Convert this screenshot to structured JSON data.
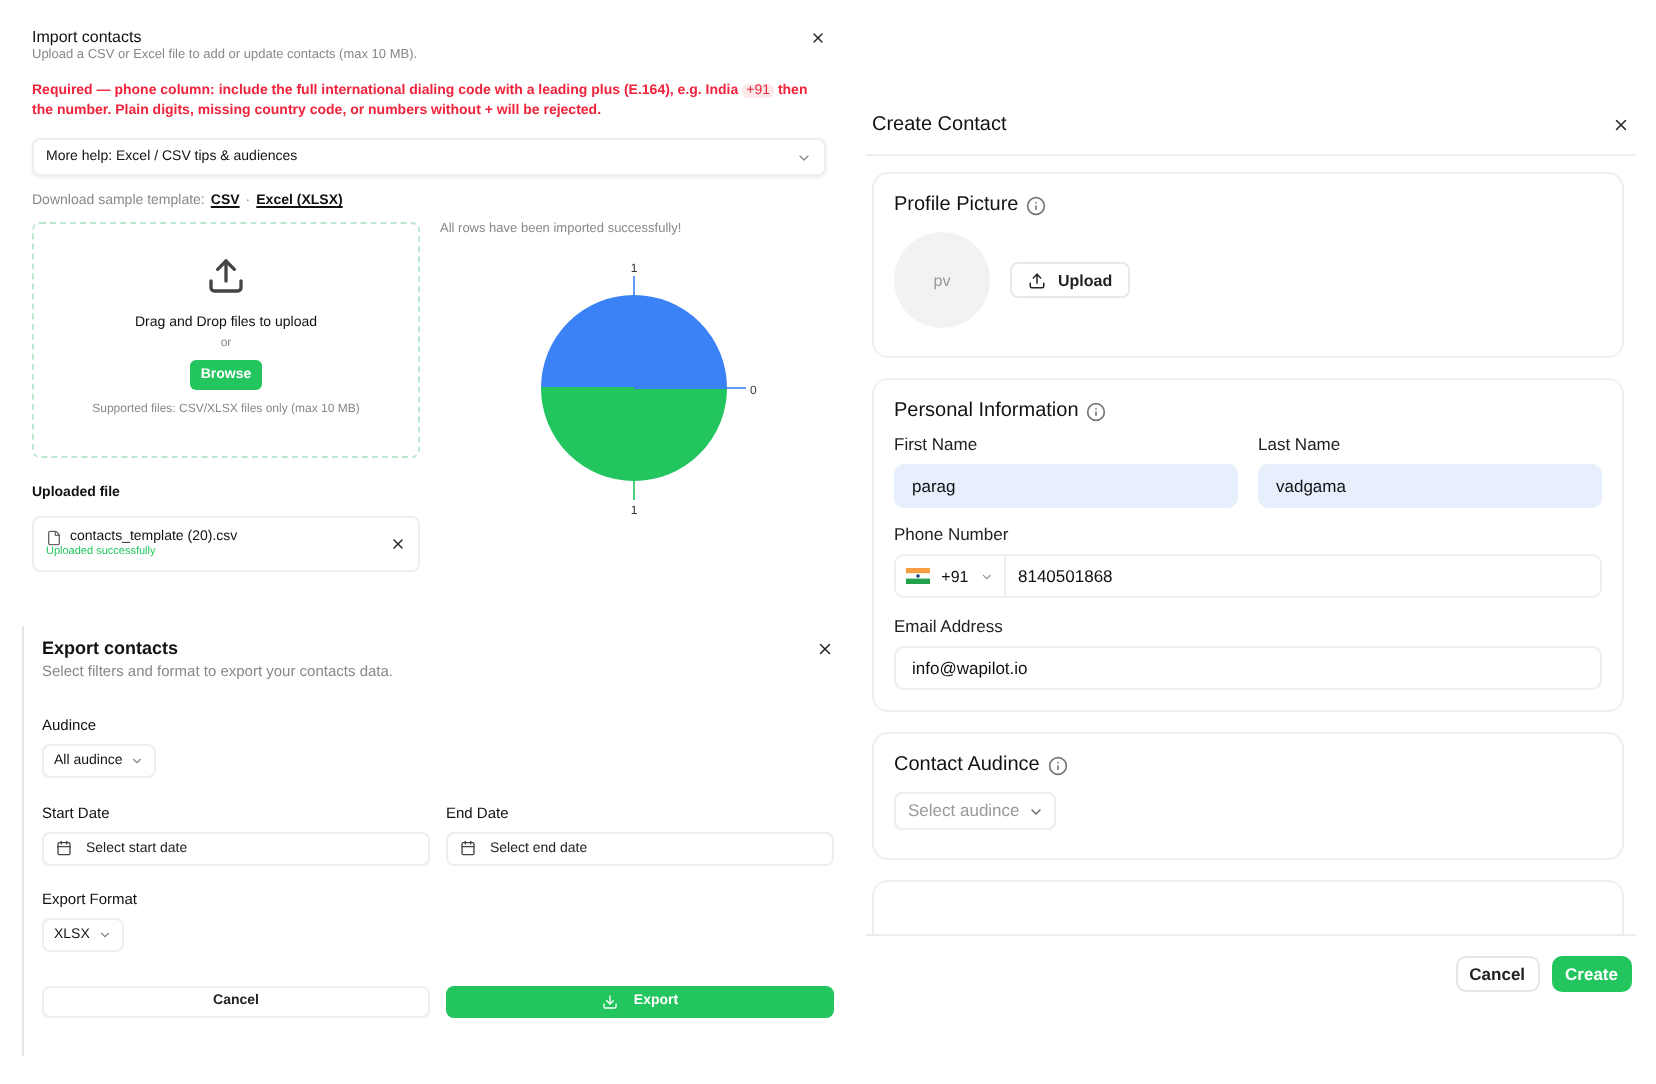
{
  "import_dialog": {
    "title": "Import contacts",
    "subtitle": "Upload a CSV or Excel file to add or update contacts (max 10 MB).",
    "warning": {
      "before": "Required — phone column: include the full international dialing code with a leading plus (E.164), e.g. India",
      "code": "+91",
      "after": "then the number. Plain digits, missing country code, or numbers without + will be rejected."
    },
    "help_accordion": {
      "label": "More help: Excel / CSV tips & audiences",
      "expanded": false
    },
    "template": {
      "label": "Download sample template:",
      "links": [
        "CSV",
        "Excel (XLSX)"
      ],
      "separator": "·"
    },
    "dropzone": {
      "title": "Drag and Drop files to upload",
      "or": "or",
      "button": "Browse",
      "hint": "Supported files: CSV/XLSX files only (max 10 MB)"
    },
    "uploaded_heading": "Uploaded file",
    "file": {
      "name": "contacts_template (20).csv",
      "status": "Uploaded successfully"
    },
    "result": {
      "message": "All rows have been imported successfully!",
      "chart_data": {
        "type": "pie",
        "values": [
          1,
          1,
          0
        ],
        "value_labels": [
          "1",
          "1",
          "0"
        ]
      }
    }
  },
  "export_dialog": {
    "title": "Export contacts",
    "subtitle": "Select filters and format to export your contacts data.",
    "audience": {
      "label": "Audince",
      "value": "All audince"
    },
    "start_date": {
      "label": "Start Date",
      "placeholder": "Select start date"
    },
    "end_date": {
      "label": "End Date",
      "placeholder": "Select end date"
    },
    "format": {
      "label": "Export Format",
      "value": "XLSX"
    },
    "buttons": [
      {
        "label": "Cancel",
        "kind": "secondary"
      },
      {
        "label": "Export",
        "kind": "primary"
      }
    ]
  },
  "create_dialog": {
    "title": "Create Contact",
    "profile": {
      "heading": "Profile Picture",
      "initials": "pv",
      "upload": "Upload"
    },
    "personal": {
      "heading": "Personal Information",
      "first_name": {
        "label": "First Name",
        "value": "parag"
      },
      "last_name": {
        "label": "Last Name",
        "value": "vadgama"
      },
      "phone": {
        "label": "Phone Number",
        "code": "+91",
        "value": "8140501868"
      },
      "email": {
        "label": "Email Address",
        "value": "info@wapilot.io"
      }
    },
    "audience": {
      "heading": "Contact Audince",
      "placeholder": "Select audince"
    },
    "buttons": [
      {
        "label": "Cancel",
        "kind": "secondary"
      },
      {
        "label": "Create",
        "kind": "primary"
      }
    ]
  }
}
